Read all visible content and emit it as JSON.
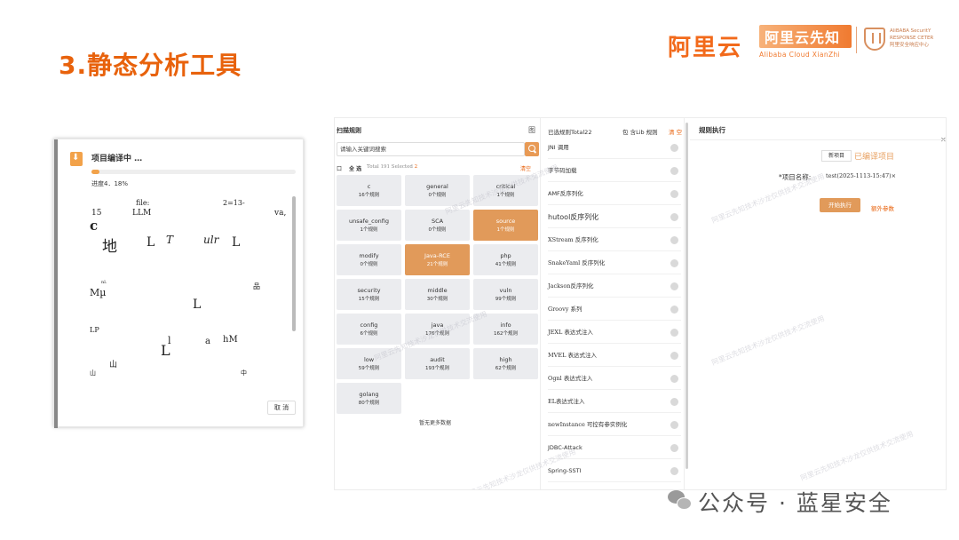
{
  "slide": {
    "title": "3.静态分析工具",
    "brand_aliyun": "阿里云",
    "brand_xianzhi_cn": "阿里云先知",
    "brand_xianzhi_en": "Alibaba Cloud XianZhi",
    "brand_asrc_en_1": "AliBABA SecuritY",
    "brand_asrc_en_2": "RESPONSE CETER",
    "brand_asrc_cn": "阿里安全响应中心",
    "footer": "公众号 · 蓝星安全"
  },
  "popup": {
    "title": "项目编译中 …",
    "progress_text": "进度4．18%",
    "progress_fraction": 0.04,
    "cancel_label": "取 消",
    "garbled": {
      "t1": "file:",
      "t2": "2=13-",
      "t3": "15",
      "t4": "LLM",
      "t5": "va,",
      "t6": "c",
      "t7": "地",
      "t8": "L",
      "t9": "T",
      "t10": "ulr",
      "t11": "L",
      "t12": "nl.",
      "t13": "品",
      "t14": "Mµ",
      "t15": "L",
      "t16": "LP",
      "t17": "l",
      "t18": "a",
      "t19": "hM",
      "t20": "L",
      "t21": "山",
      "t22": "山",
      "t23": "中"
    }
  },
  "scan": {
    "title": "扫描规则",
    "title_icon": "图",
    "search_placeholder": "请输入关键词搜索",
    "checkbox": "口",
    "select_all": "全 选",
    "total_text": "Total 191 Selected",
    "selected_count": "2",
    "clear_label": "清空",
    "no_more": "暂无更多数据",
    "tiles": [
      {
        "name": "c",
        "count": "16个规则"
      },
      {
        "name": "general",
        "count": "0个规则"
      },
      {
        "name": "critical",
        "count": "1个规则"
      },
      {
        "name": "unsafe_config",
        "count": "1个规则"
      },
      {
        "name": "SCA",
        "count": "0个规则"
      },
      {
        "name": "source",
        "count": "1个规则"
      },
      {
        "name": "modify",
        "count": "0个规则"
      },
      {
        "name": "Java-RCE",
        "count": "21个规则"
      },
      {
        "name": "php",
        "count": "41个规则"
      },
      {
        "name": "security",
        "count": "15个规则"
      },
      {
        "name": "middle",
        "count": "30个规则"
      },
      {
        "name": "vuln",
        "count": "99个规则"
      },
      {
        "name": "config",
        "count": "6个规则"
      },
      {
        "name": "java",
        "count": "176个规则"
      },
      {
        "name": "info",
        "count": "162个规则"
      },
      {
        "name": "low",
        "count": "59个规则"
      },
      {
        "name": "audit",
        "count": "193个规则"
      },
      {
        "name": "high",
        "count": "62个规则"
      },
      {
        "name": "golang",
        "count": "80个规则"
      }
    ]
  },
  "selected": {
    "title": "已选规则Total22",
    "pkg_label": "包 含Lib 规则",
    "clear_label": "清 空",
    "items": [
      "JNI 调用",
      "字节码加载",
      "AMF反序列化",
      "hutool反序列化",
      "XStream 反序列化",
      "SnakeYaml 反序列化",
      "Jackson反序列化",
      "Groovy 系列",
      "JEXL 表达式注入",
      "MVEL 表达式注入",
      "Ognl 表达式注入",
      "EL表达式注入",
      "newInstance 可控有参实例化",
      "JDBC-Attack",
      "Spring-SSTI"
    ]
  },
  "exec": {
    "title": "规则执行",
    "close_icon": "✕",
    "tab_new": "新项目",
    "tab_compiled": "已编译项目",
    "project_label": "*项目名称:",
    "project_value": "test(2025-1113-15:47)×",
    "run_label": "开始执行",
    "extra_label": "额外参数"
  },
  "watermark": "阿里云先知技术沙龙仅供技术交流使用",
  "colors": {
    "accent": "#e8620c",
    "tile_active": "#e19a5a"
  }
}
